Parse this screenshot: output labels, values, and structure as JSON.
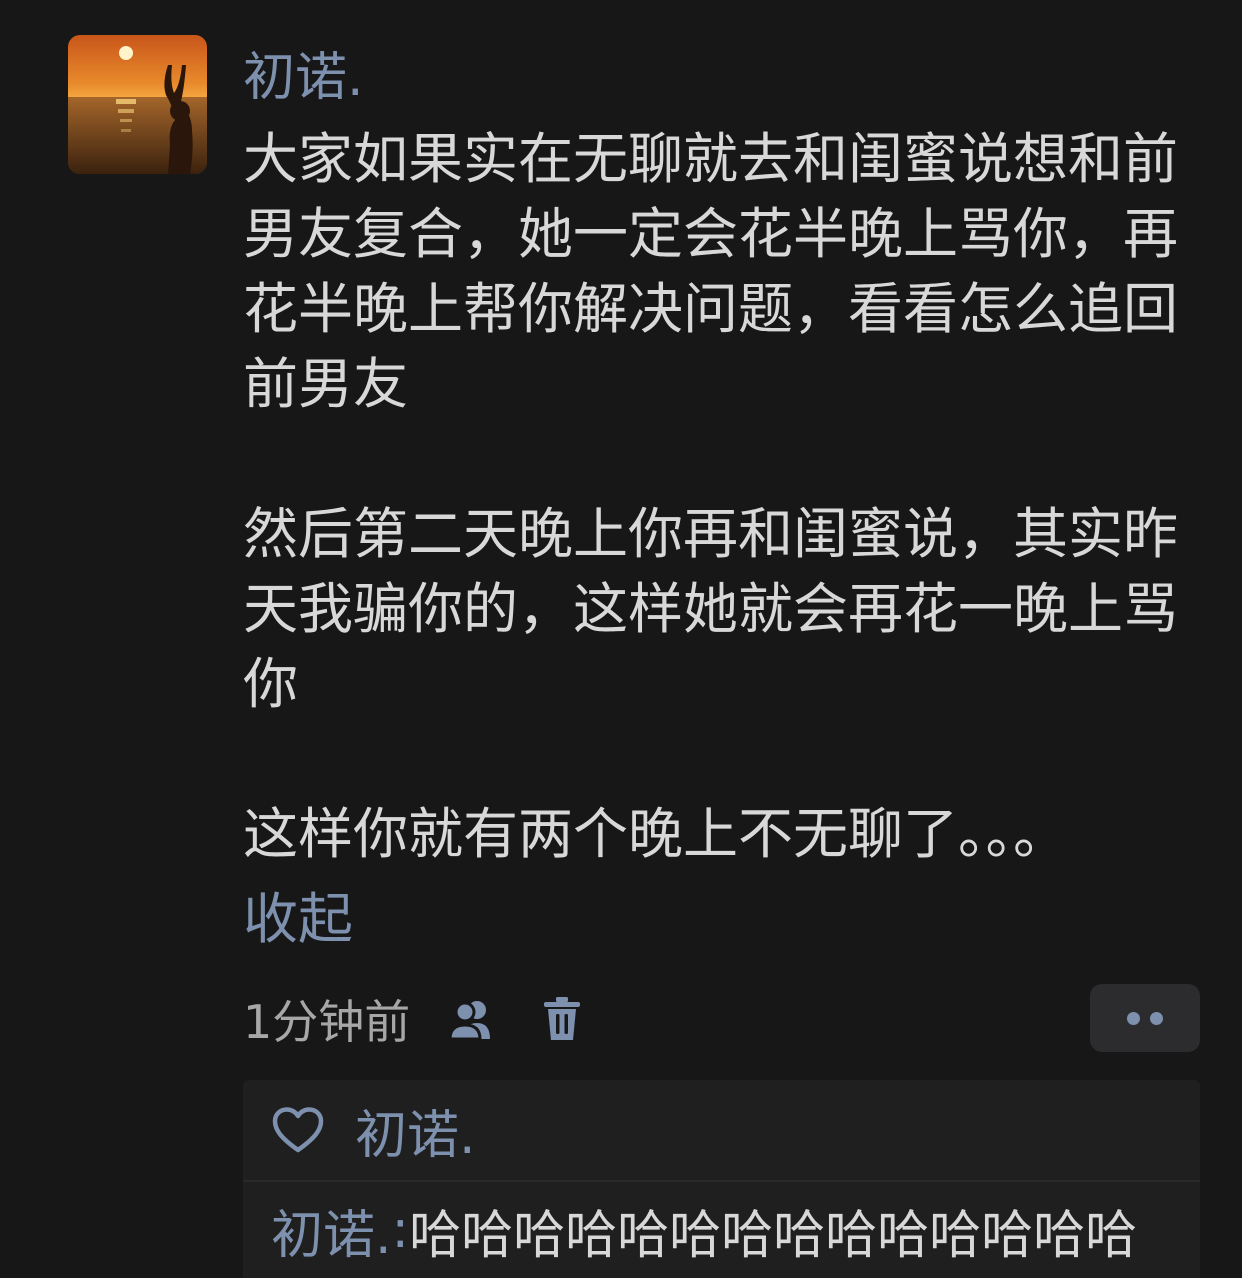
{
  "post": {
    "author": "初诺.",
    "paragraphs": [
      "大家如果实在无聊就去和闺蜜说想和前男友复合，她一定会花半晚上骂你，再花半晚上帮你解决问题，看看怎么追回前男友",
      "然后第二天晚上你再和闺蜜说，其实昨天我骗你的，这样她就会再花一晚上骂你",
      "这样你就有两个晚上不无聊了。。。"
    ],
    "collapse_label": "收起",
    "timestamp": "1分钟前",
    "visibility_icon": "friends-icon",
    "delete_icon": "trash-icon",
    "more_icon": "more-dots-icon"
  },
  "interactions": {
    "likes_icon": "heart-outline-icon",
    "likes": [
      "初诺."
    ],
    "comments": [
      {
        "author": "初诺.",
        "separator": ":",
        "text": "哈哈哈哈哈哈哈哈哈哈哈哈哈哈"
      }
    ]
  },
  "colors": {
    "background": "#171717",
    "panel": "#1f1f1f",
    "link": "#7d90ad",
    "text": "#d8d8d8",
    "muted": "#a7a7a7",
    "button_bg": "#2c2c2e"
  }
}
